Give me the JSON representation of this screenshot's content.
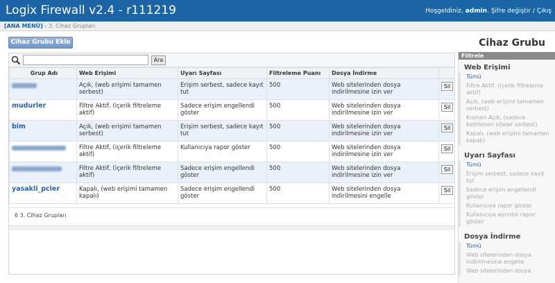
{
  "header": {
    "title": "Logix Firewall v2.4 - r111219",
    "greeting": "Hoşgeldiniz,",
    "username": "admin",
    "separator": ".",
    "change_password": "Şifre değiştir",
    "slash": "/",
    "logout": "Çıkış"
  },
  "breadcrumb": {
    "main_menu": "[ANA MENÜ]",
    "arrow": "›",
    "current": "3. Cihaz Grupları"
  },
  "toolbar": {
    "add_label": "Cihaz Grubu Ekle",
    "page_heading": "Cihaz Grubu"
  },
  "search": {
    "value": "",
    "button_label": "Ara"
  },
  "table": {
    "columns": [
      "Grup Adı",
      "Web Erişimi",
      "Uyarı Sayfası",
      "Filtreleme Puanı",
      "Dosya İndirme",
      ""
    ],
    "delete_label": "Sil",
    "rows": [
      {
        "name": "",
        "web": "Açık, (web erişimi tamamen serbest)",
        "warning": "Erişim serbest, sadece kayıt tut",
        "score": "500",
        "download": "Web sitelerinden dosya indirilmesine izin ver"
      },
      {
        "name": "mudurler",
        "web": "Filtre Aktif, (içerik filtreleme aktif)",
        "warning": "Sadece erişim engellendi göster",
        "score": "500",
        "download": "Web sitelerinden dosya indirilmesine izin ver"
      },
      {
        "name": "bim",
        "web": "Açık, (web erişimi tamamen serbest)",
        "warning": "Erişim serbest, sadece kayıt tut",
        "score": "500",
        "download": "Web sitelerinden dosya indirilmesine izin ver"
      },
      {
        "name": "",
        "web": "Filtre Aktif, (içerik filtreleme aktif)",
        "warning": "Kullanıcıya rapor göster",
        "score": "500",
        "download": "Web sitelerinden dosya indirilmesine izin ver"
      },
      {
        "name": "",
        "web": "Filtre Aktif, (içerik filtreleme aktif)",
        "warning": "Sadece erişim engellendi göster",
        "score": "500",
        "download": "Web sitelerinden dosya indirilmesine izin ver"
      },
      {
        "name": "yasakli_pcler",
        "web": "Kapalı, (web erişimi tamamen kapalı)",
        "warning": "Sadece erişim engellendi göster",
        "score": "500",
        "download": "Web sitelerinden dosya indirilmesini engelle"
      }
    ]
  },
  "footer": {
    "status": "6 3. Cihaz Grupları"
  },
  "filter": {
    "header": "Filtrele",
    "sections": [
      {
        "title": "Web Erişimi",
        "items": [
          "Tümü",
          "Filtre Aktif, (içerik filtreleme aktif)",
          "Açık, (web erişimi tamamen serbest)",
          "Kısmen Açık, (sadece belirlenen siteler serbest)",
          "Kapalı, (web erişimi tamamen kapalı)"
        ]
      },
      {
        "title": "Uyarı Sayfası",
        "items": [
          "Tümü",
          "Erişim serbest, sadece kayıt tut",
          "Sadece erişim engellendi göster",
          "Kullanıcıya rapor göster",
          "Kullanıcıya ayrıntılı rapor göster"
        ]
      },
      {
        "title": "Dosya İndirme",
        "items": [
          "Tümü",
          "Web sitelerinden dosya indirilmesine engelle",
          "Web sitelerinden dosya"
        ]
      }
    ]
  },
  "colors": {
    "topbar": "#1b65a7",
    "link": "#2a5fa8",
    "row_alt": "#eaf1fa"
  }
}
